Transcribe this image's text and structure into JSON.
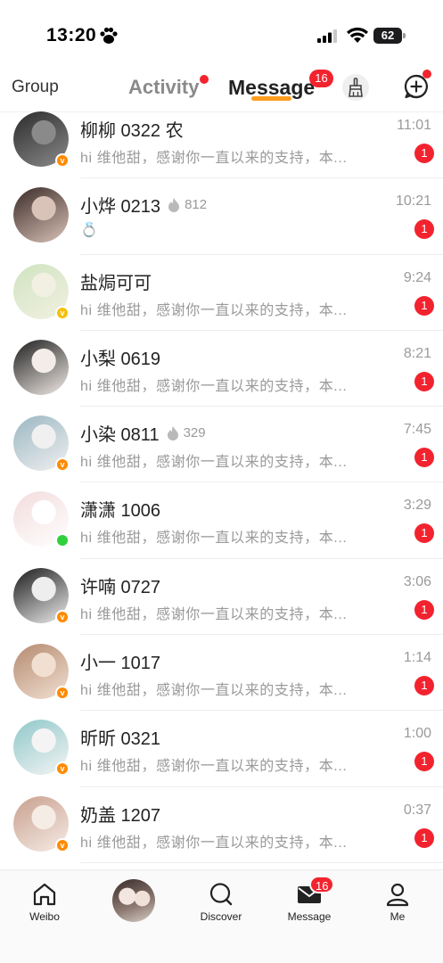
{
  "status_bar": {
    "time": "13:20",
    "battery": "62"
  },
  "header": {
    "tab_group": "Group",
    "tab_activity": "Activity",
    "tab_message": "Message",
    "message_badge": "16"
  },
  "conversations": [
    {
      "name": "柳柳 0322 农",
      "preview": "hi 维他甜，感谢你一直以来的支持，本...",
      "time": "11:01",
      "unread": "1",
      "badge": "orange",
      "fire": "",
      "avatar_colors": [
        "#2b2b2b",
        "#8a8a8a"
      ]
    },
    {
      "name": "小烨 0213",
      "preview": "💍",
      "time": "10:21",
      "unread": "1",
      "badge": "none",
      "fire": "812",
      "avatar_colors": [
        "#3a2a26",
        "#d9c2b8"
      ]
    },
    {
      "name": "盐焗可可",
      "preview": "hi 维他甜，感谢你一直以来的支持，本...",
      "time": "9:24",
      "unread": "1",
      "badge": "gold",
      "fire": "",
      "avatar_colors": [
        "#cfe4c0",
        "#f2f0e2"
      ]
    },
    {
      "name": "小梨 0619",
      "preview": "hi 维他甜，感谢你一直以来的支持，本...",
      "time": "8:21",
      "unread": "1",
      "badge": "none",
      "fire": "",
      "avatar_colors": [
        "#1e1e1e",
        "#f3ece8"
      ]
    },
    {
      "name": "小染 0811",
      "preview": "hi 维他甜，感谢你一直以来的支持，本...",
      "time": "7:45",
      "unread": "1",
      "badge": "orange",
      "fire": "329",
      "avatar_colors": [
        "#9ab7c2",
        "#f0f0f0"
      ]
    },
    {
      "name": "潇潇 1006",
      "preview": "hi 维他甜，感谢你一直以来的支持，本...",
      "time": "3:29",
      "unread": "1",
      "badge": "online",
      "fire": "",
      "avatar_colors": [
        "#f3dcdc",
        "#ffffff"
      ]
    },
    {
      "name": "许喃 0727",
      "preview": "hi 维他甜，感谢你一直以来的支持，本...",
      "time": "3:06",
      "unread": "1",
      "badge": "orange",
      "fire": "",
      "avatar_colors": [
        "#1a1a1a",
        "#eeeeee"
      ]
    },
    {
      "name": "小一 1017",
      "preview": "hi 维他甜，感谢你一直以来的支持，本...",
      "time": "1:14",
      "unread": "1",
      "badge": "orange",
      "fire": "",
      "avatar_colors": [
        "#b58a70",
        "#f1e0d2"
      ]
    },
    {
      "name": "昕昕 0321",
      "preview": "hi 维他甜，感谢你一直以来的支持，本...",
      "time": "1:00",
      "unread": "1",
      "badge": "orange",
      "fire": "",
      "avatar_colors": [
        "#8fc8c9",
        "#f4f4f4"
      ]
    },
    {
      "name": "奶盖 1207",
      "preview": "hi 维他甜，感谢你一直以来的支持，本...",
      "time": "0:37",
      "unread": "1",
      "badge": "orange",
      "fire": "",
      "avatar_colors": [
        "#c89f8d",
        "#f6ece6"
      ]
    }
  ],
  "bottom_nav": {
    "weibo": "Weibo",
    "discover": "Discover",
    "message": "Message",
    "message_badge": "16",
    "me": "Me"
  },
  "colors": {
    "accent_red": "#f2232e",
    "underline_orange": "#ff9d1f"
  }
}
